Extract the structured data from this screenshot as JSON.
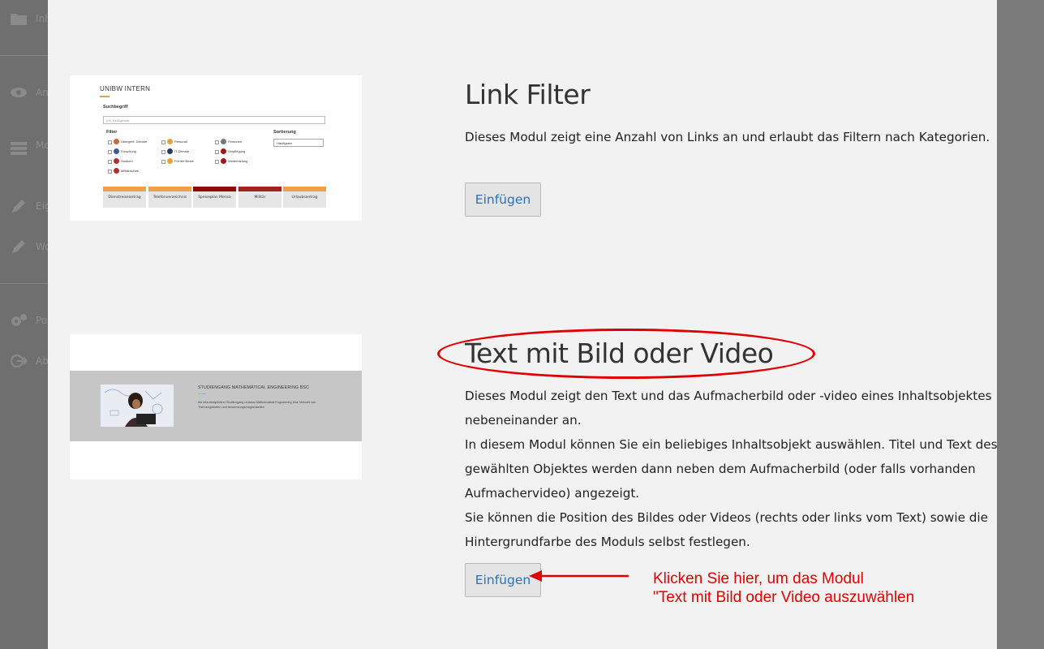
{
  "sidebar": {
    "items": [
      {
        "icon": "folder-icon",
        "label": "Inhalte"
      },
      {
        "icon": "eye-icon",
        "label": "Ansicht"
      },
      {
        "icon": "modules-icon",
        "label": "Module einfügen"
      },
      {
        "icon": "pencil-icon",
        "label": "Eigenschaften"
      },
      {
        "icon": "pencil-icon",
        "label": "Workflow"
      },
      {
        "icon": "gears-icon",
        "label": "Portal"
      },
      {
        "icon": "logout-icon",
        "label": "Abmelden"
      }
    ]
  },
  "modules": [
    {
      "title": "Link Filter",
      "description": "Dieses Modul zeigt eine Anzahl von Links an und erlaubt das Filtern nach Kategorien.",
      "button": "Einfügen",
      "preview": {
        "brand": "UNIBW INTERN",
        "search_label": "Suchbegriff",
        "search_placeholder": "z.B. Einfügeantr.",
        "filter_label": "Filter",
        "sort_label": "Sortierung",
        "sort_value": "Häufigsten",
        "filters": [
          "Übergreif. Dienste",
          "Forschung",
          "Studium",
          "Militärisches",
          "Personal",
          "IT-Dienste",
          "Für die Beste",
          "Personen",
          "Verpflegung",
          "Weiterbildung"
        ],
        "tiles": [
          "Dienstreiseantrag",
          "Telefonverzeichnis",
          "Speiseplan Mensa",
          "Militär",
          "Urlaubsantrag"
        ]
      }
    },
    {
      "title": "Text mit Bild oder Video",
      "description_lines": [
        "Dieses Modul zeigt den Text und das Aufmacherbild oder -video eines Inhaltsobjektes nebeneinander an.",
        "In diesem Modul können Sie ein beliebiges Inhaltsobjekt auswählen. Titel und Text des gewählten Objektes werden dann neben dem Aufmacherbild (oder falls vorhanden Aufmachervideo) angezeigt.",
        "Sie können die Position des Bildes oder Videos (rechts oder links vom Text) sowie die Hintergrundfarbe des Moduls selbst festlegen."
      ],
      "button": "Einfügen",
      "preview": {
        "heading": "STUDIENGANG MATHEMATICAL ENGINEERING BSC",
        "text": "Als interdisziplinärer Studiengang umfasst Mathematical Engineering eine Vielzahl von Themengebieten und Anwendungsmöglichkeiten"
      }
    }
  ],
  "annotation": {
    "text": "Klicken Sie hier, um das Modul\n\"Text mit Bild oder Video auszuwählen",
    "color": "#e00000"
  },
  "colors": {
    "link_blue": "#2f6fb3",
    "tile_orange": "#f0a04b",
    "tile_darkred": "#8b0a0a"
  }
}
